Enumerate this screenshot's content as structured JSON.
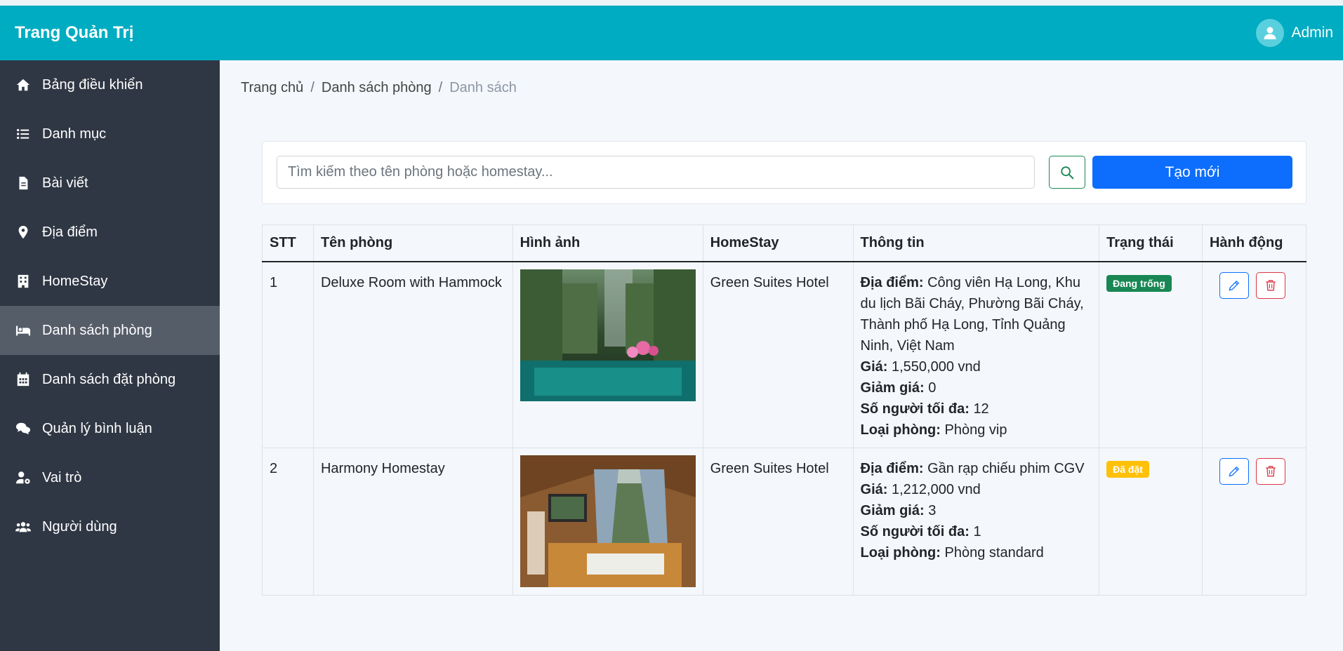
{
  "header": {
    "brand": "Trang Quản Trị",
    "user_name": "Admin"
  },
  "sidebar": {
    "items": [
      {
        "label": "Bảng điều khiển",
        "icon": "home-icon"
      },
      {
        "label": "Danh mục",
        "icon": "list-icon"
      },
      {
        "label": "Bài viết",
        "icon": "file-icon"
      },
      {
        "label": "Địa điểm",
        "icon": "map-pin-icon"
      },
      {
        "label": "HomeStay",
        "icon": "building-icon"
      },
      {
        "label": "Danh sách phòng",
        "icon": "bed-icon",
        "active": true
      },
      {
        "label": "Danh sách đặt phòng",
        "icon": "calendar-icon"
      },
      {
        "label": "Quản lý bình luận",
        "icon": "comments-icon"
      },
      {
        "label": "Vai trò",
        "icon": "user-cog-icon"
      },
      {
        "label": "Người dùng",
        "icon": "users-icon"
      }
    ]
  },
  "breadcrumb": {
    "home": "Trang chủ",
    "section": "Danh sách phòng",
    "current": "Danh sách",
    "separator": "/"
  },
  "search": {
    "placeholder": "Tìm kiếm theo tên phòng hoặc homestay...",
    "value": "",
    "create_label": "Tạo mới"
  },
  "table": {
    "headers": [
      "STT",
      "Tên phòng",
      "Hình ảnh",
      "HomeStay",
      "Thông tin",
      "Trạng thái",
      "Hành động"
    ],
    "rows": [
      {
        "stt": "1",
        "room_name": "Deluxe Room with Hammock",
        "homestay": "Green Suites Hotel",
        "info": {
          "location_label": "Địa điểm:",
          "location": "Công viên Hạ Long, Khu du lịch Bãi Cháy, Phường Bãi Cháy, Thành phố Hạ Long, Tỉnh Quảng Ninh, Việt Nam",
          "price_label": "Giá:",
          "price": "1,550,000 vnd",
          "discount_label": "Giảm giá:",
          "discount": "0",
          "max_label": "Số người tối đa:",
          "max_people": "12",
          "type_label": "Loại phòng:",
          "room_type": "Phòng vip"
        },
        "status": "Đang trống",
        "status_color": "#198754"
      },
      {
        "stt": "2",
        "room_name": "Harmony Homestay",
        "homestay": "Green Suites Hotel",
        "info": {
          "location_label": "Địa điểm:",
          "location": "Gần rạp chiếu phim CGV",
          "price_label": "Giá:",
          "price": "1,212,000 vnd",
          "discount_label": "Giảm giá:",
          "discount": "3",
          "max_label": "Số người tối đa:",
          "max_people": "1",
          "type_label": "Loại phòng:",
          "room_type": "Phòng standard"
        },
        "status": "Đã đặt",
        "status_color": "#ffc107"
      }
    ]
  },
  "colors": {
    "topbar": "#00acc1",
    "sidebar": "#2f3744",
    "sidebar_active": "#555d69",
    "primary": "#0d6efd",
    "danger": "#dc3545",
    "success": "#198754"
  }
}
